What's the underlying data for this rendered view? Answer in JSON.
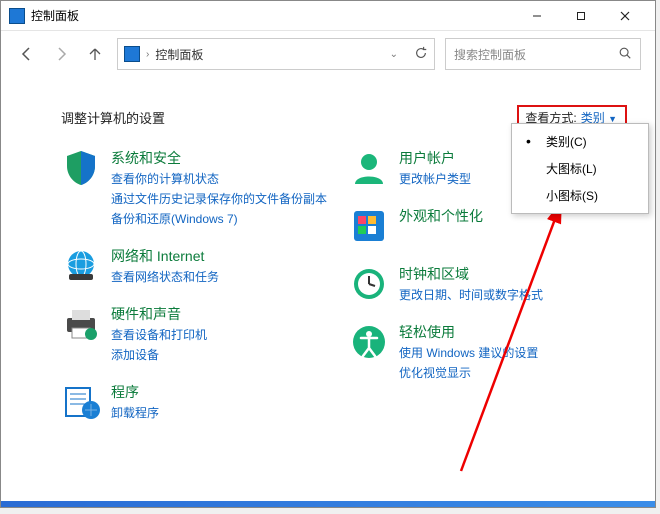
{
  "window": {
    "title": "控制面板"
  },
  "titlebar_buttons": {
    "min": "—",
    "max": "▢",
    "close": "✕"
  },
  "nav": {
    "breadcrumb": "控制面板",
    "search_placeholder": "搜索控制面板"
  },
  "content": {
    "heading": "调整计算机的设置",
    "view_label": "查看方式:",
    "view_value": "类别"
  },
  "dropdown": {
    "items": [
      {
        "label": "类别(C)",
        "selected": true
      },
      {
        "label": "大图标(L)",
        "selected": false
      },
      {
        "label": "小图标(S)",
        "selected": false
      }
    ]
  },
  "categories_left": [
    {
      "title": "系统和安全",
      "subs": [
        "查看你的计算机状态",
        "通过文件历史记录保存你的文件备份副本",
        "备份和还原(Windows 7)"
      ]
    },
    {
      "title": "网络和 Internet",
      "subs": [
        "查看网络状态和任务"
      ]
    },
    {
      "title": "硬件和声音",
      "subs": [
        "查看设备和打印机",
        "添加设备"
      ]
    },
    {
      "title": "程序",
      "subs": [
        "卸载程序"
      ]
    }
  ],
  "categories_right": [
    {
      "title": "用户帐户",
      "subs": [
        "更改帐户类型"
      ]
    },
    {
      "title": "外观和个性化",
      "subs": []
    },
    {
      "title": "时钟和区域",
      "subs": [
        "更改日期、时间或数字格式"
      ]
    },
    {
      "title": "轻松使用",
      "subs": [
        "使用 Windows 建议的设置",
        "优化视觉显示"
      ]
    }
  ],
  "icons": {
    "shield": "shield-icon",
    "globe": "globe-icon",
    "printer": "printer-icon",
    "programs": "programs-icon",
    "user": "user-icon",
    "appearance": "appearance-icon",
    "clock": "clock-icon",
    "ease": "ease-icon"
  }
}
